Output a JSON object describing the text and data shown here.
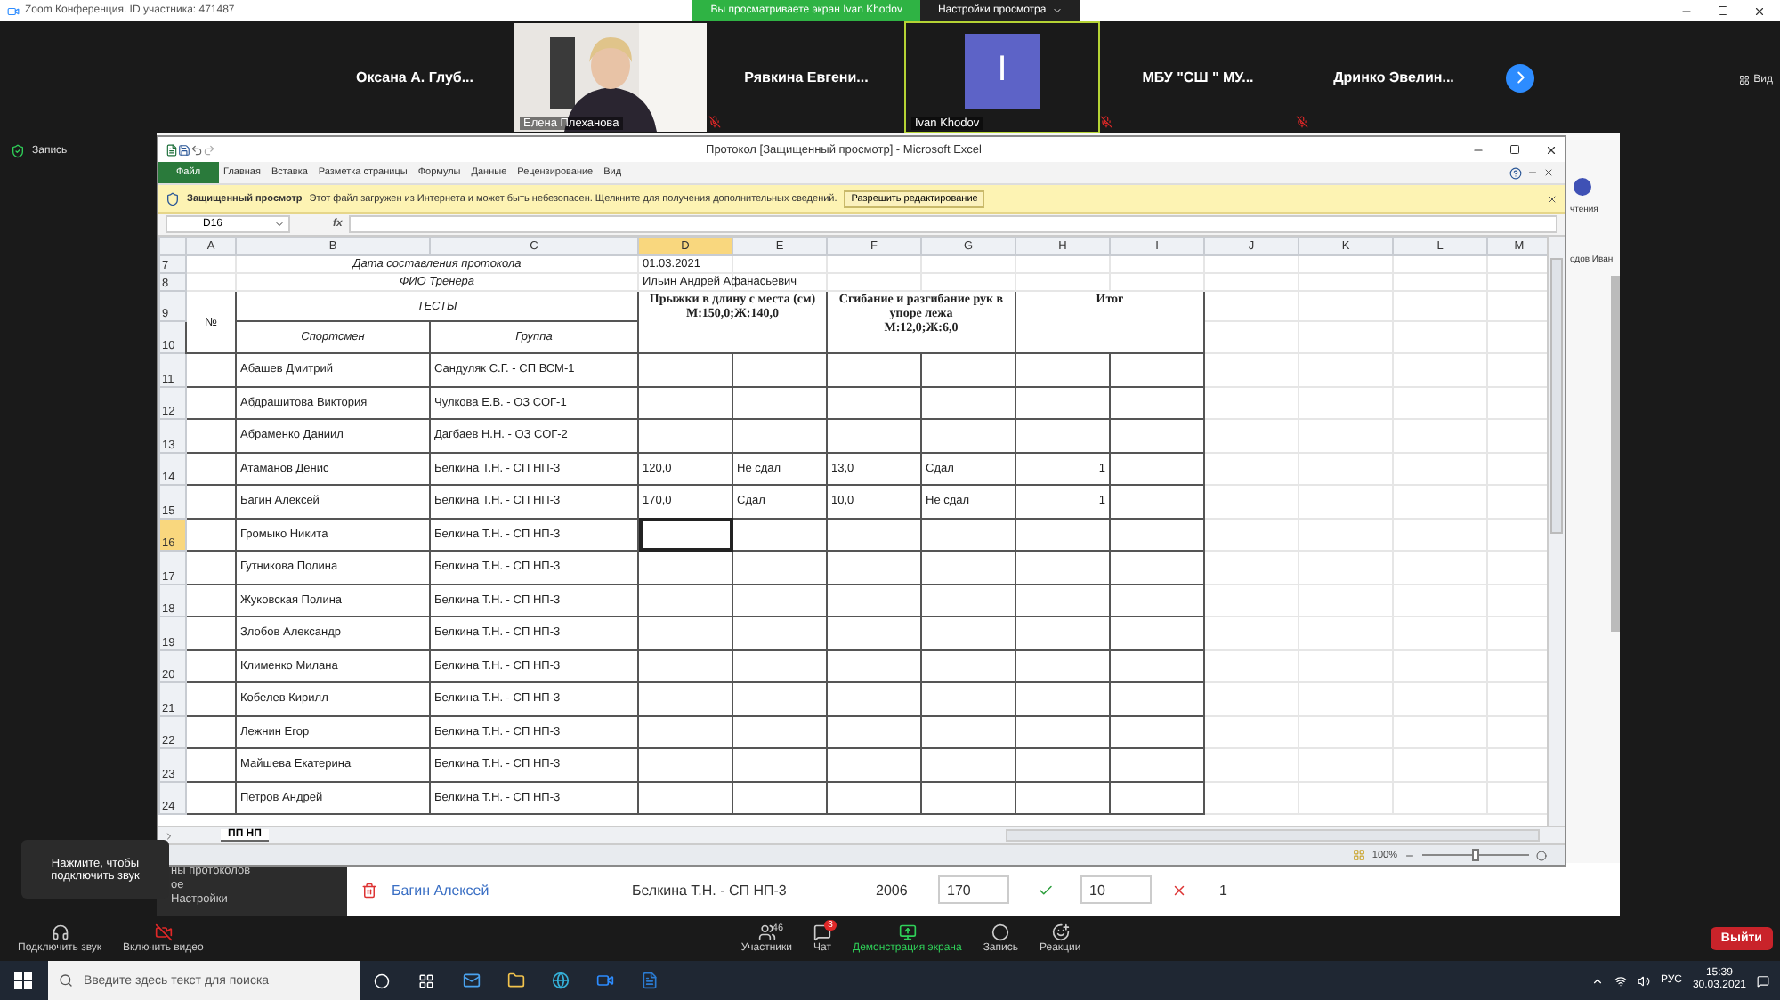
{
  "zoom": {
    "title": "Zoom Конференция. ID участника: 471487",
    "banner": "Вы просматриваете экран Ivan Khodov",
    "view_options": "Настройки просмотра",
    "view": "Вид",
    "recording": "Запись"
  },
  "gallery": [
    {
      "name": "Оксана  А.  Глуб...",
      "kind": "name",
      "muted": false,
      "selected": false
    },
    {
      "name": "Елена Плеханова",
      "kind": "video",
      "muted": false,
      "selected": false
    },
    {
      "name": "Рявкина  Евгени...",
      "kind": "name",
      "muted": true,
      "selected": false
    },
    {
      "name": "Ivan Khodov",
      "kind": "avatar",
      "initial": "I",
      "muted": false,
      "selected": true
    },
    {
      "name": "МБУ  \"СШ \"  МУ...",
      "kind": "name",
      "muted": true,
      "selected": false
    },
    {
      "name": "Дринко  Эвелин...",
      "kind": "name",
      "muted": true,
      "selected": false
    }
  ],
  "excel": {
    "title": "Протокол  [Защищенный просмотр]  -  Microsoft Excel",
    "ribbon_tabs": [
      {
        "label": "Файл",
        "kind": "file"
      },
      {
        "label": "Главная",
        "kind": "tab"
      },
      {
        "label": "Вставка",
        "kind": "tab"
      },
      {
        "label": "Разметка страницы",
        "kind": "tab"
      },
      {
        "label": "Формулы",
        "kind": "tab"
      },
      {
        "label": "Данные",
        "kind": "tab"
      },
      {
        "label": "Рецензирование",
        "kind": "tab"
      },
      {
        "label": "Вид",
        "kind": "tab"
      }
    ],
    "protected_bar": {
      "title": "Защищенный просмотр",
      "message": "Этот файл загружен из Интернета и может быть небезопасен. Щелкните для получения дополнительных сведений.",
      "button": "Разрешить редактирование"
    },
    "name_box": "D16",
    "formula_label": "fx",
    "columns": [
      {
        "label": "A",
        "selected": false
      },
      {
        "label": "B",
        "selected": false
      },
      {
        "label": "C",
        "selected": false
      },
      {
        "label": "D",
        "selected": true
      },
      {
        "label": "E",
        "selected": false
      },
      {
        "label": "F",
        "selected": false
      },
      {
        "label": "G",
        "selected": false
      },
      {
        "label": "H",
        "selected": false
      },
      {
        "label": "I",
        "selected": false
      },
      {
        "label": "J",
        "selected": false
      },
      {
        "label": "K",
        "selected": false
      },
      {
        "label": "L",
        "selected": false
      },
      {
        "label": "M",
        "selected": false
      }
    ],
    "info_rows": [
      {
        "num": "7",
        "label": "Дата составления протокола",
        "value": "01.03.2021"
      },
      {
        "num": "8",
        "label": "ФИО Тренера",
        "value": "Ильин Андрей Афанасьевич"
      }
    ],
    "header": {
      "nums": [
        "9",
        "10"
      ],
      "number": "№",
      "tests": "ТЕСТЫ",
      "athlete": "Спортсмен",
      "group": "Группа",
      "test_1": "Прыжки в длину с места (см)",
      "norm_1": "М:150,0;Ж:140,0",
      "test_2": "Сгибание и разгибание рук в упоре лежа",
      "norm_2": "М:12,0;Ж:6,0",
      "total": "Итог"
    },
    "rows": [
      {
        "num": "11",
        "athlete": "Абашев Дмитрий",
        "group": "Сандуляк С.Г. - СП ВСМ-1",
        "selected": false
      },
      {
        "num": "12",
        "athlete": "Абдрашитова Виктория",
        "group": "Чулкова Е.В. - ОЗ СОГ-1",
        "selected": false
      },
      {
        "num": "13",
        "athlete": "Абраменко Даниил",
        "group": "Дагбаев Н.Н. - ОЗ СОГ-2",
        "selected": false
      },
      {
        "num": "14",
        "athlete": "Атаманов Денис",
        "group": "Белкина Т.Н. - СП НП-3",
        "jump": "120,0",
        "jump_result": "Не сдал",
        "push": "13,0",
        "push_result": "Сдал",
        "total": "1",
        "selected": false
      },
      {
        "num": "15",
        "athlete": "Багин Алексей",
        "group": "Белкина Т.Н. - СП НП-3",
        "jump": "170,0",
        "jump_result": "Сдал",
        "push": "10,0",
        "push_result": "Не сдал",
        "total": "1",
        "selected": false
      },
      {
        "num": "16",
        "athlete": "Громыко Никита",
        "group": "Белкина Т.Н. - СП НП-3",
        "selected": true
      },
      {
        "num": "17",
        "athlete": "Гутникова Полина",
        "group": "Белкина Т.Н. - СП НП-3",
        "selected": false
      },
      {
        "num": "18",
        "athlete": "Жуковская Полина",
        "group": "Белкина Т.Н. - СП НП-3",
        "selected": false
      },
      {
        "num": "19",
        "athlete": "Злобов Александр",
        "group": "Белкина Т.Н. - СП НП-3",
        "selected": false
      },
      {
        "num": "20",
        "athlete": "Клименко Милана",
        "group": "Белкина Т.Н. - СП НП-3",
        "selected": false
      },
      {
        "num": "21",
        "athlete": "Кобелев Кирилл",
        "group": "Белкина Т.Н. - СП НП-3",
        "selected": false
      },
      {
        "num": "22",
        "athlete": "Лежнин Егор",
        "group": "Белкина Т.Н. - СП НП-3",
        "selected": false
      },
      {
        "num": "23",
        "athlete": "Майшева Екатерина",
        "group": "Белкина Т.Н. - СП НП-3",
        "selected": false
      },
      {
        "num": "24",
        "athlete": "Петров Андрей",
        "group": "Белкина Т.Н. - СП НП-3",
        "selected": false
      }
    ],
    "sheet_tab": "ПП НП",
    "zoom_level": "100%",
    "zoom_slider": {
      "level": 0.5
    }
  },
  "shared_page": {
    "sidebar": [
      "ны протоколов",
      "ое",
      "Настройки"
    ],
    "right_texts": [
      "чтения",
      "одов Иван"
    ],
    "row": {
      "name": "Багин Алексей",
      "group": "Белкина Т.Н. - СП НП-3",
      "year": "2006",
      "jump": "170",
      "jump_passed": true,
      "push": "10",
      "push_passed": false,
      "total": "1"
    }
  },
  "tooltip": "Нажмите, чтобы подключить звук",
  "toolbar": [
    {
      "label": "Подключить звук",
      "kind": "audio"
    },
    {
      "label": "Включить видео",
      "kind": "video"
    },
    {
      "label": "Участники",
      "kind": "participants",
      "count": "46"
    },
    {
      "label": "Чат",
      "kind": "chat",
      "badge": "3"
    },
    {
      "label": "Демонстрация экрана",
      "kind": "share"
    },
    {
      "label": "Запись",
      "kind": "record"
    },
    {
      "label": "Реакции",
      "kind": "reactions"
    }
  ],
  "leave": "Выйти",
  "taskbar": {
    "search_placeholder": "Введите здесь текст для поиска",
    "language": "РУС",
    "time": "15:39",
    "date": "30.03.2021"
  }
}
